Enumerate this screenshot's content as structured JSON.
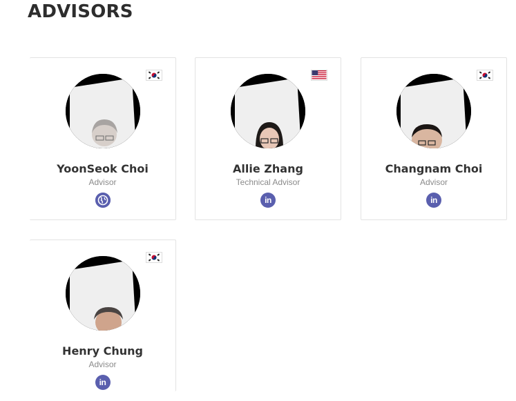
{
  "section": {
    "title": "ADVISORS"
  },
  "advisors": [
    {
      "name": "YoonSeok Choi",
      "role": "Advisor",
      "flag": "south-korea",
      "social": "globe-icon"
    },
    {
      "name": "Allie Zhang",
      "role": "Technical Advisor",
      "flag": "united-states",
      "social": "linkedin-icon"
    },
    {
      "name": "Changnam Choi",
      "role": "Advisor",
      "flag": "south-korea",
      "social": "linkedin-icon"
    },
    {
      "name": "Henry Chung",
      "role": "Advisor",
      "flag": "south-korea",
      "social": "linkedin-icon"
    }
  ],
  "icons": {
    "linkedin_text": "in"
  },
  "colors": {
    "social_button": "#5a5fae",
    "card_border": "#e2e2e2",
    "title": "#2d2d2d",
    "role_text": "#8a8a8a"
  }
}
